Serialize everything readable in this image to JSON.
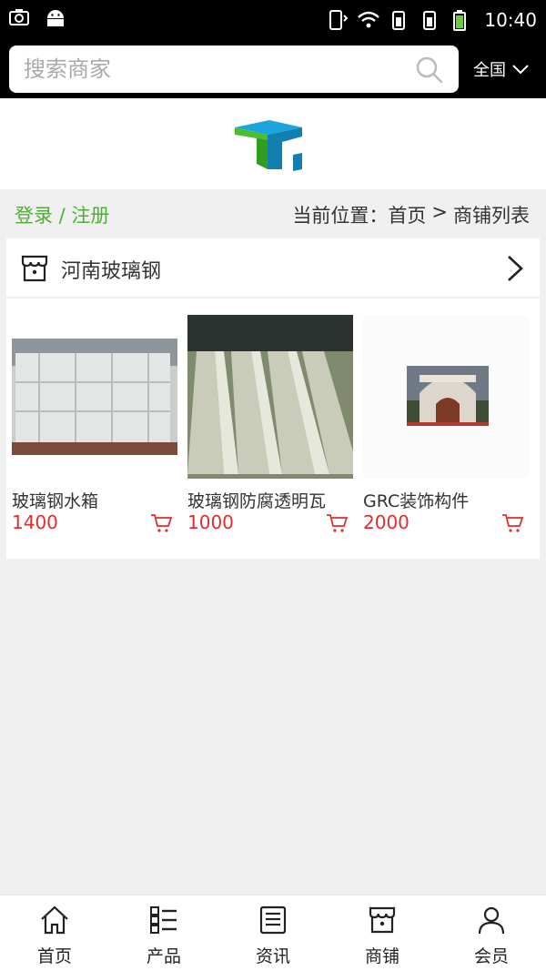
{
  "status_bar": {
    "time": "10:40"
  },
  "search": {
    "placeholder": "搜索商家",
    "region": "全国"
  },
  "breadcrumb": {
    "login": "登录 / 注册",
    "prefix": "当前位置：",
    "home": "首页",
    "sep": ">",
    "current": "商铺列表"
  },
  "shop": {
    "name": "河南玻璃钢"
  },
  "products": [
    {
      "name": "玻璃钢水箱",
      "price": "1400"
    },
    {
      "name": "玻璃钢防腐透明瓦",
      "price": "1000"
    },
    {
      "name": "GRC装饰构件",
      "price": "2000"
    }
  ],
  "nav": [
    {
      "label": "首页",
      "icon": "home-icon"
    },
    {
      "label": "产品",
      "icon": "list-icon"
    },
    {
      "label": "资讯",
      "icon": "news-icon"
    },
    {
      "label": "商铺",
      "icon": "store-icon"
    },
    {
      "label": "会员",
      "icon": "user-icon"
    }
  ],
  "colors": {
    "accent_green": "#4caf35",
    "price_red": "#e42b2b",
    "header_bg": "#000000"
  }
}
